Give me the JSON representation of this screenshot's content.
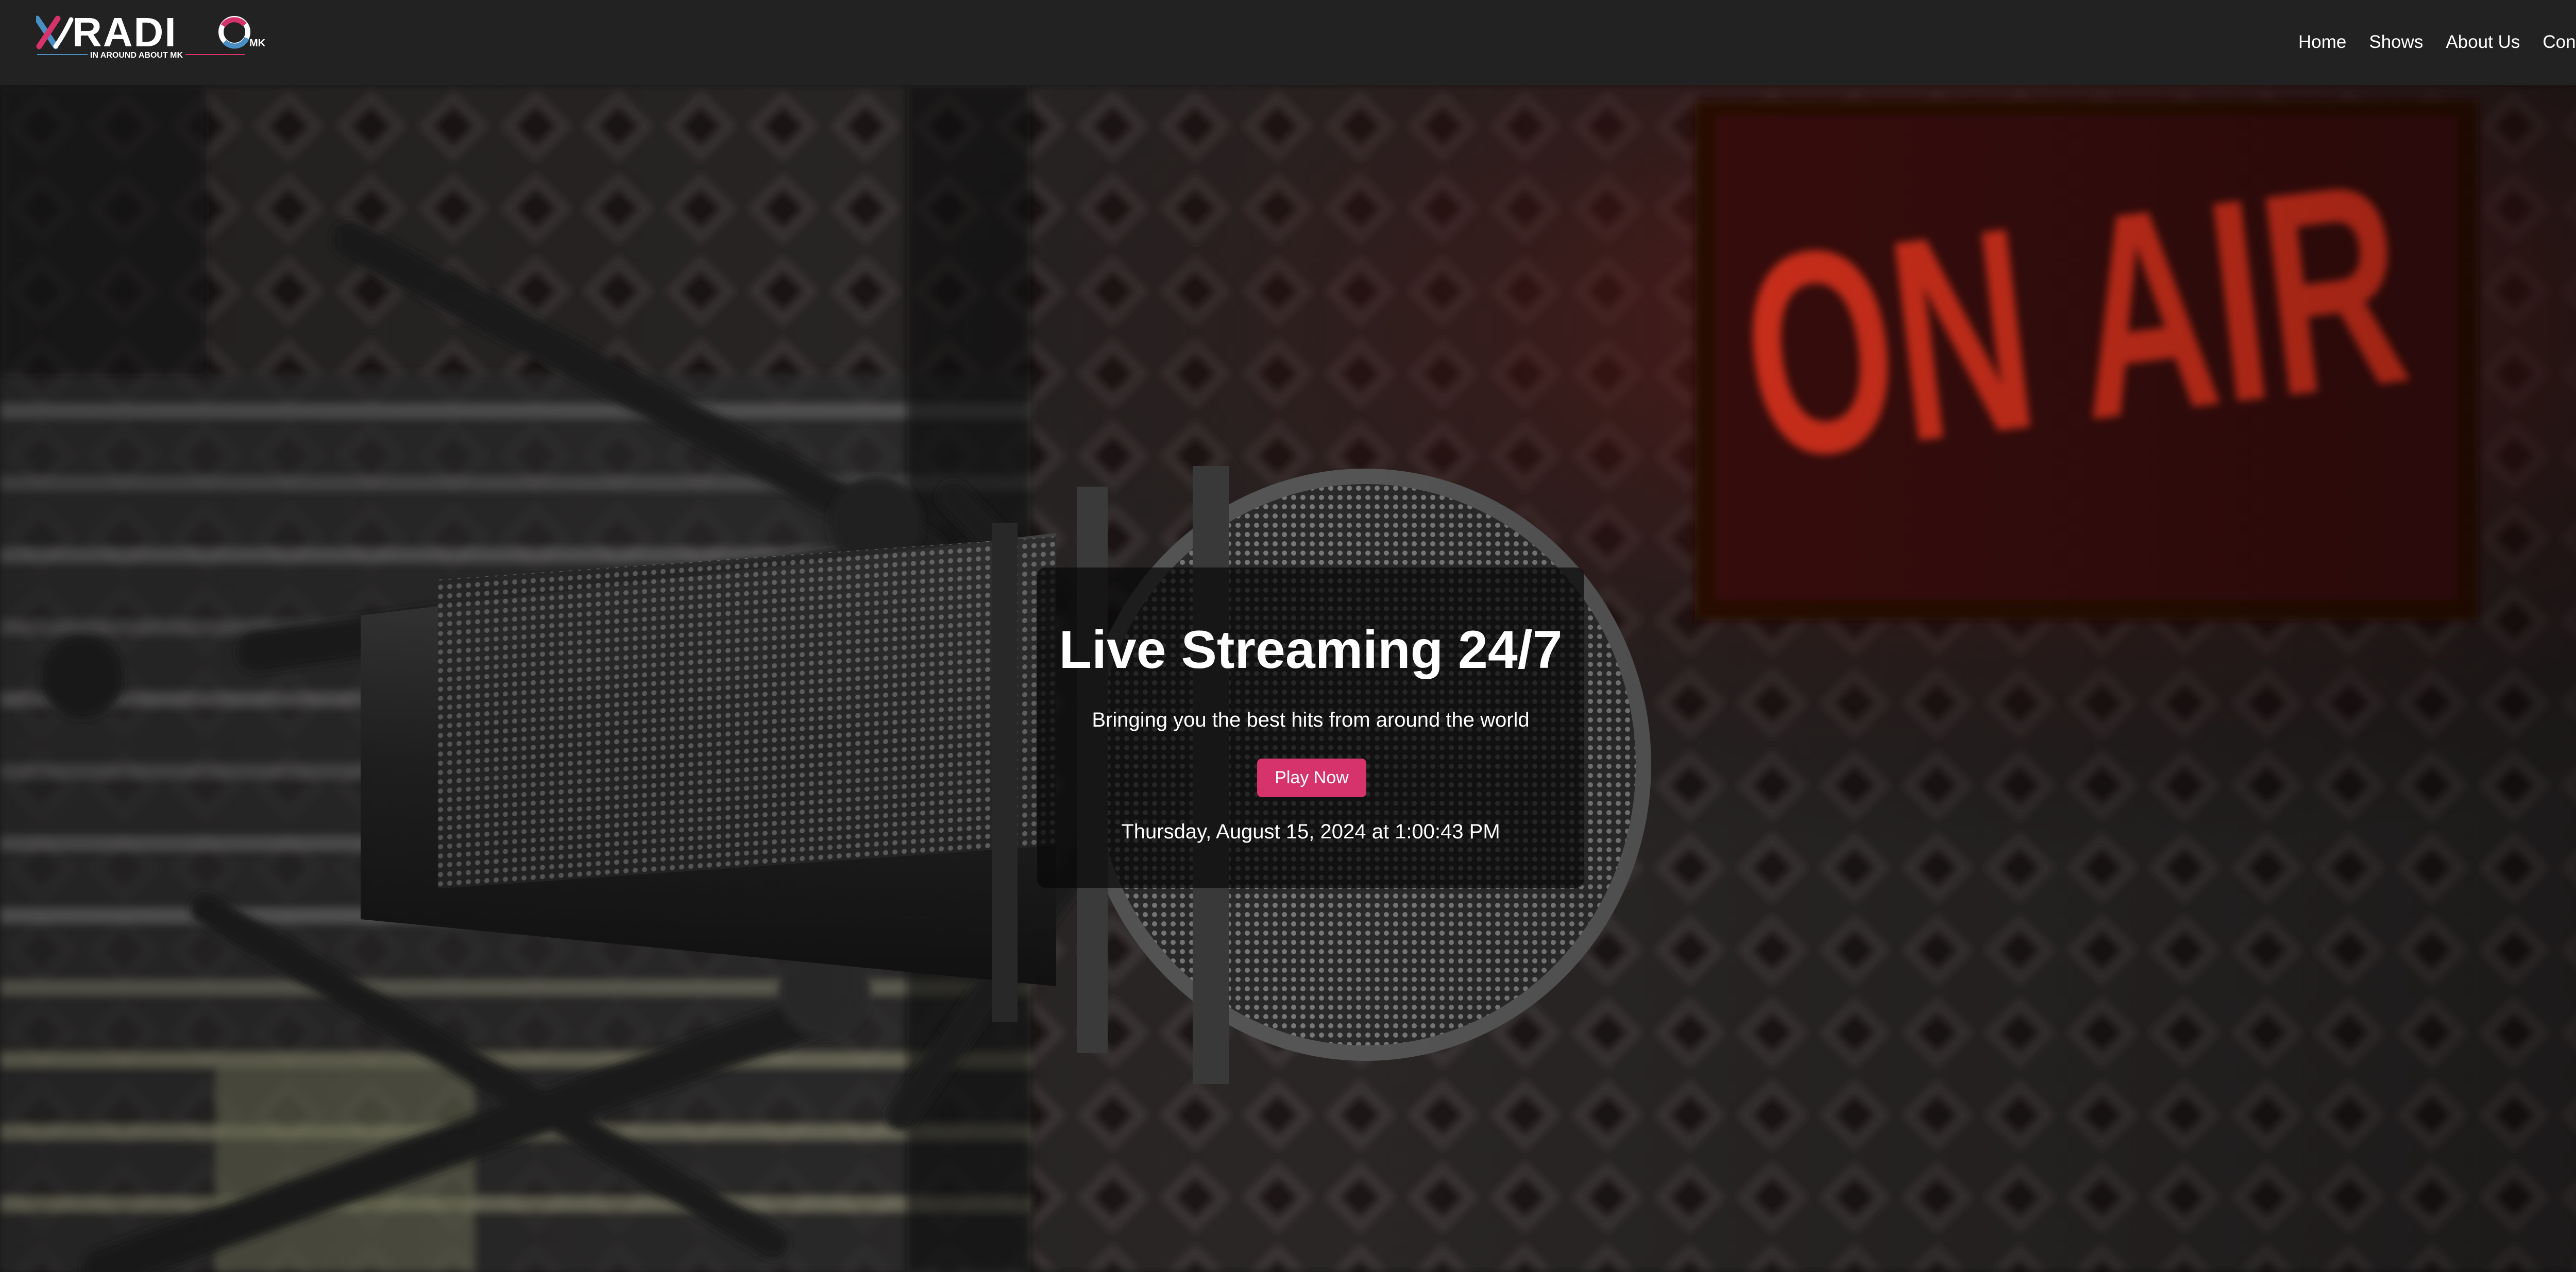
{
  "brand": {
    "logo_text": "XRADIO",
    "logo_suffix": "MK",
    "tagline": "IN AROUND ABOUT MK",
    "colors": {
      "x_blue": "#4a8fc4",
      "x_pink": "#d6336c",
      "text": "#ffffff"
    }
  },
  "nav": {
    "items": [
      {
        "label": "Home"
      },
      {
        "label": "Shows"
      },
      {
        "label": "About Us"
      },
      {
        "label": "Contact"
      }
    ]
  },
  "hero": {
    "background": "radio studio microphone with red ON AIR sign on acoustic foam wall",
    "sign_text": "ON AIR",
    "title": "Live Streaming 24/7",
    "subtitle": "Bringing you the best hits from around the world",
    "play_label": "Play Now",
    "datetime": "Thursday, August 15, 2024 at 1:00:43 PM",
    "colors": {
      "button": "#d6336c",
      "card": "rgba(8,8,8,0.72)",
      "sign_red": "#e0321f"
    }
  }
}
